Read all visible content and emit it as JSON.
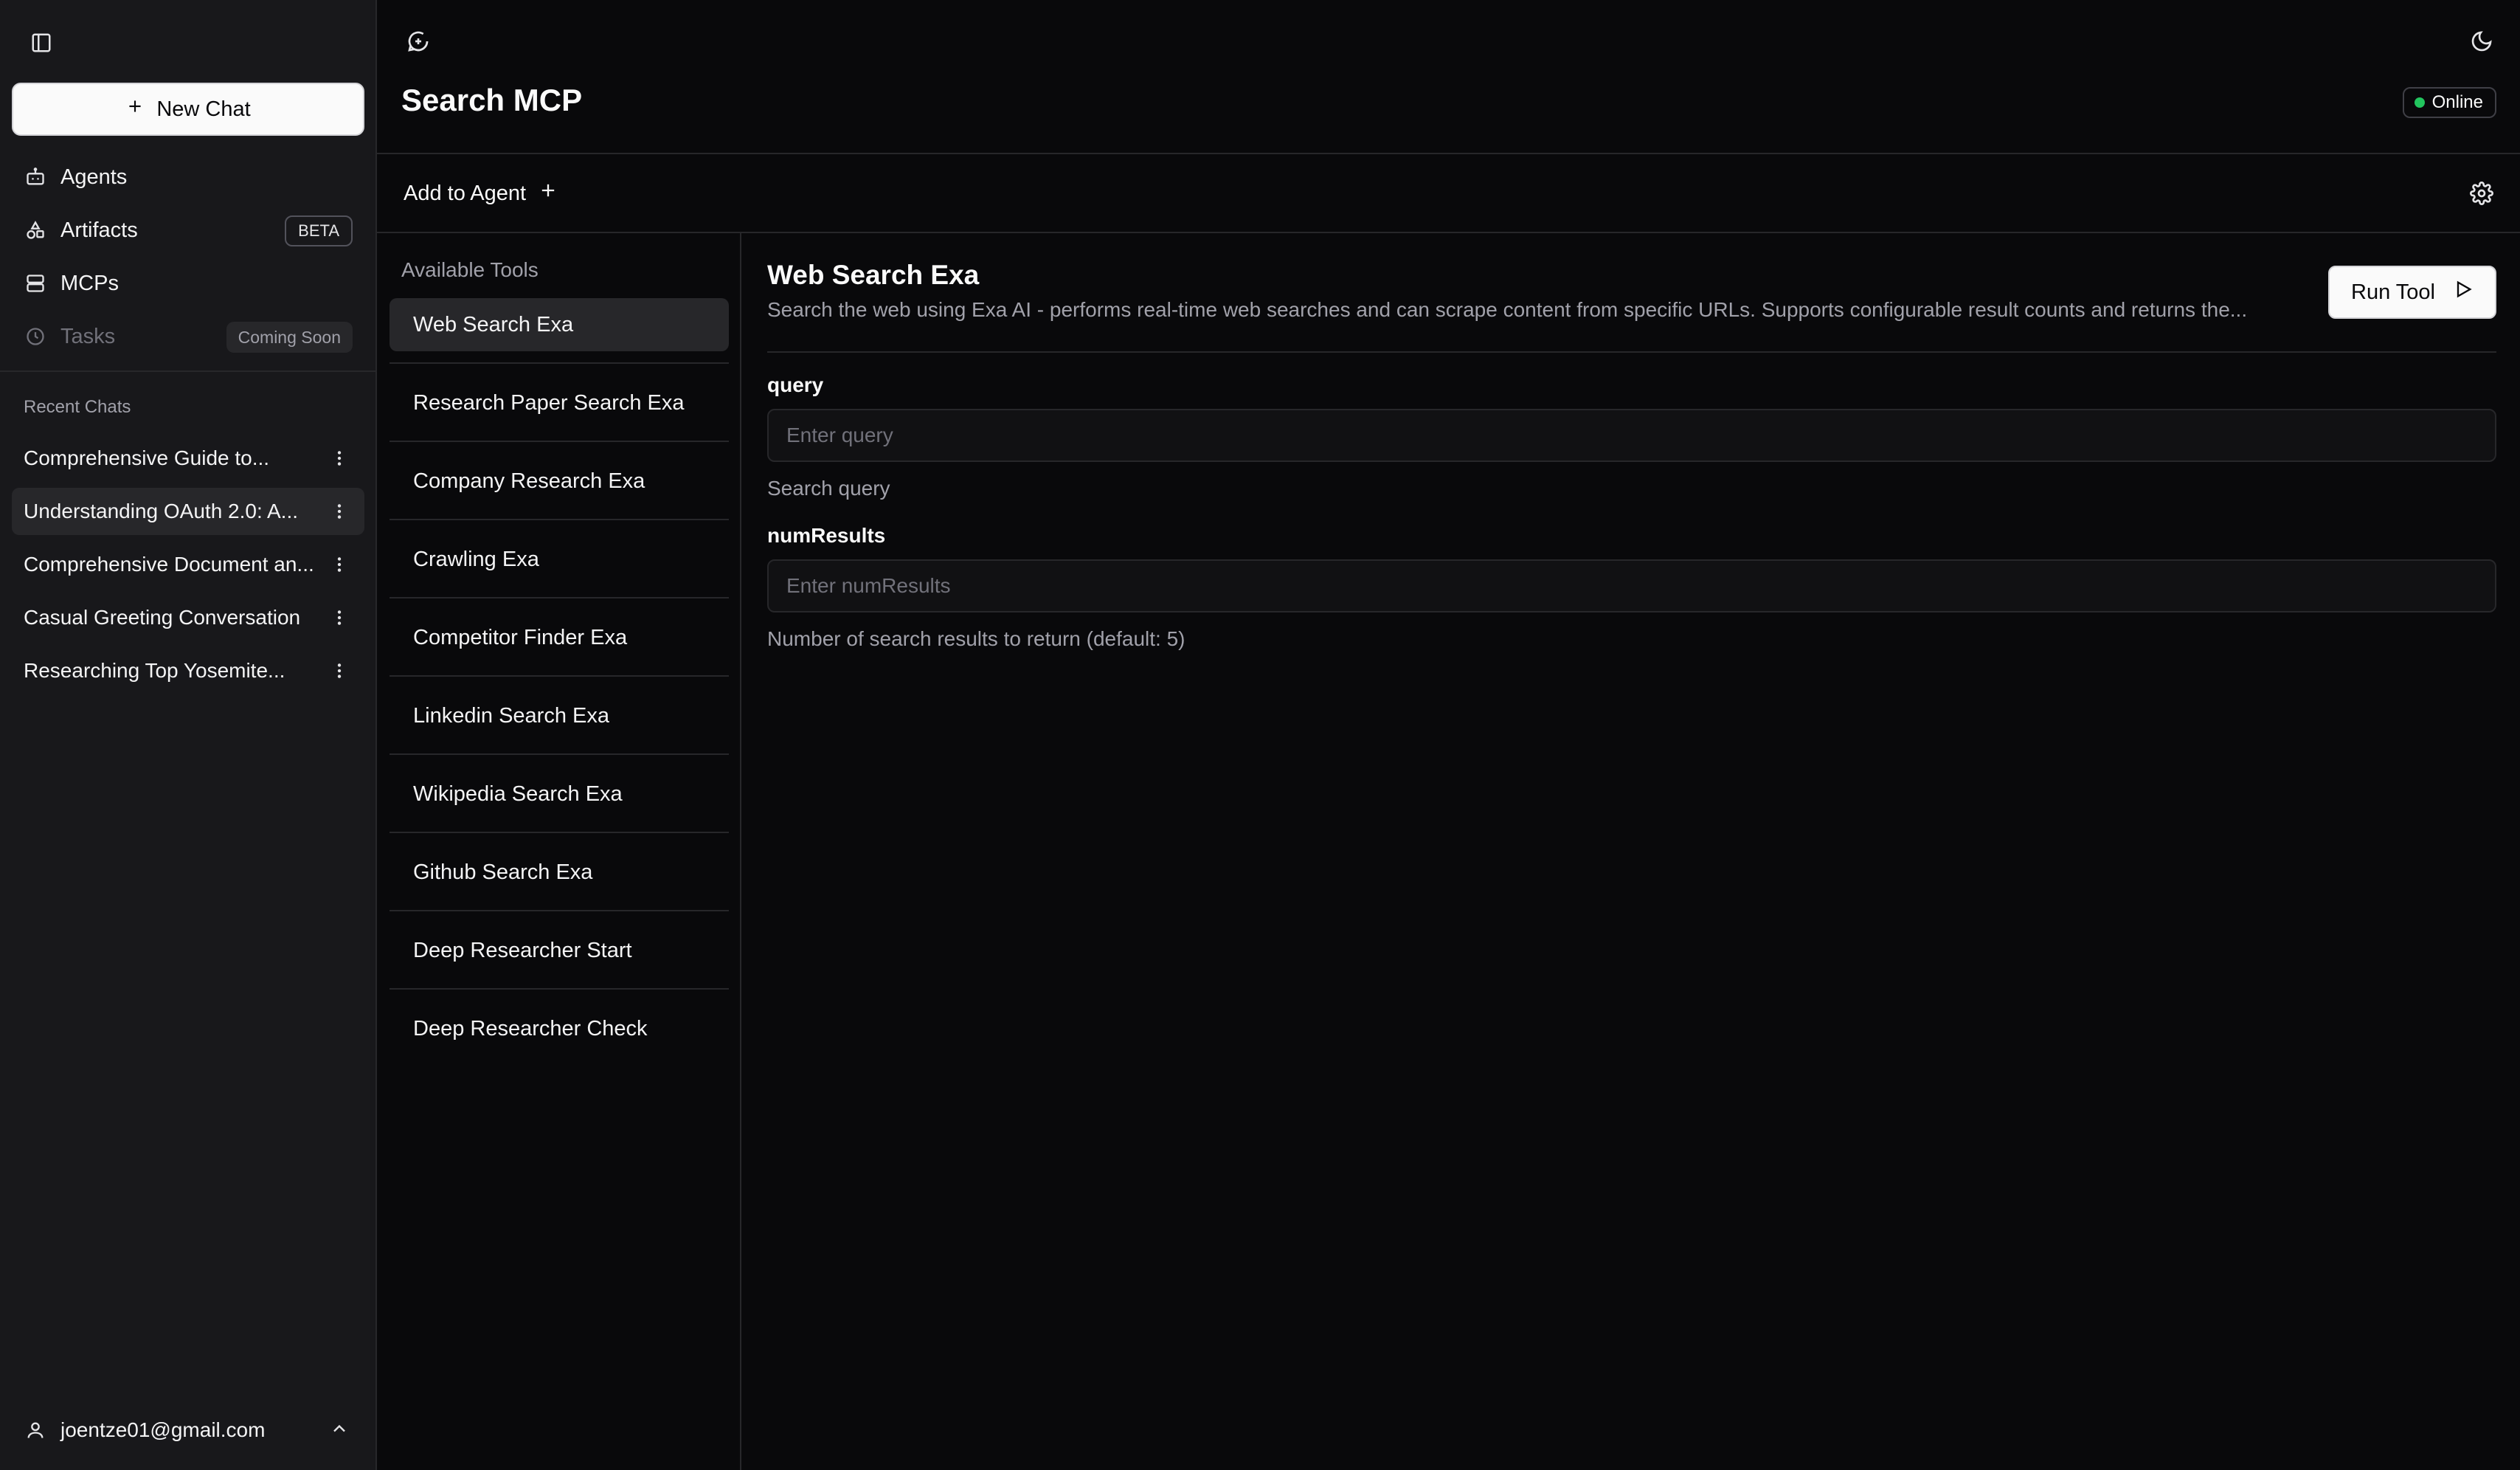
{
  "sidebar": {
    "new_chat_label": "New Chat",
    "nav": [
      {
        "label": "Agents",
        "icon": "bot-icon"
      },
      {
        "label": "Artifacts",
        "icon": "shapes-icon",
        "badge": "BETA"
      },
      {
        "label": "MCPs",
        "icon": "server-icon"
      },
      {
        "label": "Tasks",
        "icon": "clock-icon",
        "badge": "Coming Soon"
      }
    ],
    "recent_label": "Recent Chats",
    "chats": [
      "Comprehensive Guide to...",
      "Understanding OAuth 2.0: A...",
      "Comprehensive Document an...",
      "Casual Greeting Conversation",
      "Researching Top Yosemite..."
    ],
    "user_email": "joentze01@gmail.com"
  },
  "header": {
    "title": "Search MCP",
    "status": "Online",
    "status_color": "#22c55e"
  },
  "toolbar": {
    "add_to_agent_label": "Add to Agent"
  },
  "tools": {
    "label": "Available Tools",
    "items": [
      "Web Search Exa",
      "Research Paper Search Exa",
      "Company Research Exa",
      "Crawling Exa",
      "Competitor Finder Exa",
      "Linkedin Search Exa",
      "Wikipedia Search Exa",
      "Github Search Exa",
      "Deep Researcher Start",
      "Deep Researcher Check"
    ],
    "selected": "Web Search Exa"
  },
  "detail": {
    "title": "Web Search Exa",
    "description": "Search the web using Exa AI - performs real-time web searches and can scrape content from specific URLs. Supports configurable result counts and returns the...",
    "run_label": "Run Tool",
    "fields": [
      {
        "label": "query",
        "placeholder": "Enter query",
        "help": "Search query"
      },
      {
        "label": "numResults",
        "placeholder": "Enter numResults",
        "help": "Number of search results to return (default: 5)"
      }
    ]
  }
}
